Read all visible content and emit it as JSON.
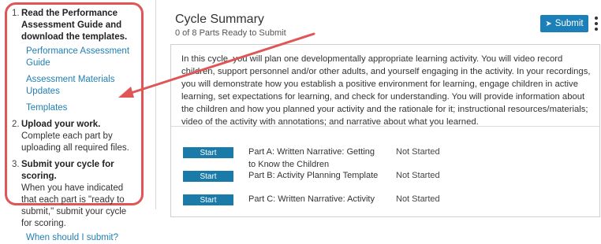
{
  "sidebar": {
    "steps": [
      {
        "number": "1.",
        "title": "Read the Performance Assessment Guide and download the templates.",
        "links": [
          "Performance Assessment Guide",
          "Assessment Materials Updates",
          "Templates"
        ]
      },
      {
        "number": "2.",
        "title": "Upload your work.",
        "description": "Complete each part by uploading all required files."
      },
      {
        "number": "3.",
        "title": "Submit your cycle for scoring.",
        "description": "When you have indicated that each part is \"ready to submit,\" submit your cycle for scoring.",
        "link": "When should I submit?"
      }
    ]
  },
  "header": {
    "title": "Cycle Summary",
    "subtitle": "0 of 8 Parts Ready to Submit",
    "submit_label": "Submit",
    "submit_icon": "paper-plane-icon",
    "menu_icon": "more-vertical-icon"
  },
  "panel": {
    "description": "In this cycle, you will plan one developmentally appropriate learning activity. You will video record children, support personnel and/or other adults, and yourself engaging in the activity. In your recordings, you will demonstrate how you establish a positive environment for learning, engage children in active learning, set expectations for learning, and check for understanding. You will provide information about the children and how you planned your activity and the rationale for it; instructional resources/materials; video of the activity with annotations; and narrative about what you learned.",
    "parts": [
      {
        "button": "Start",
        "name": "Part A: Written Narrative: Getting to Know the Children",
        "status": "Not Started"
      },
      {
        "button": "Start",
        "name": "Part B: Activity Planning Template",
        "status": "Not Started"
      },
      {
        "button": "Start",
        "name": "Part C: Written Narrative: Activity",
        "status": "Not Started"
      }
    ]
  },
  "colors": {
    "accent": "#1c7fb8",
    "link": "#1f7fb4",
    "annotation": "#e05555"
  }
}
